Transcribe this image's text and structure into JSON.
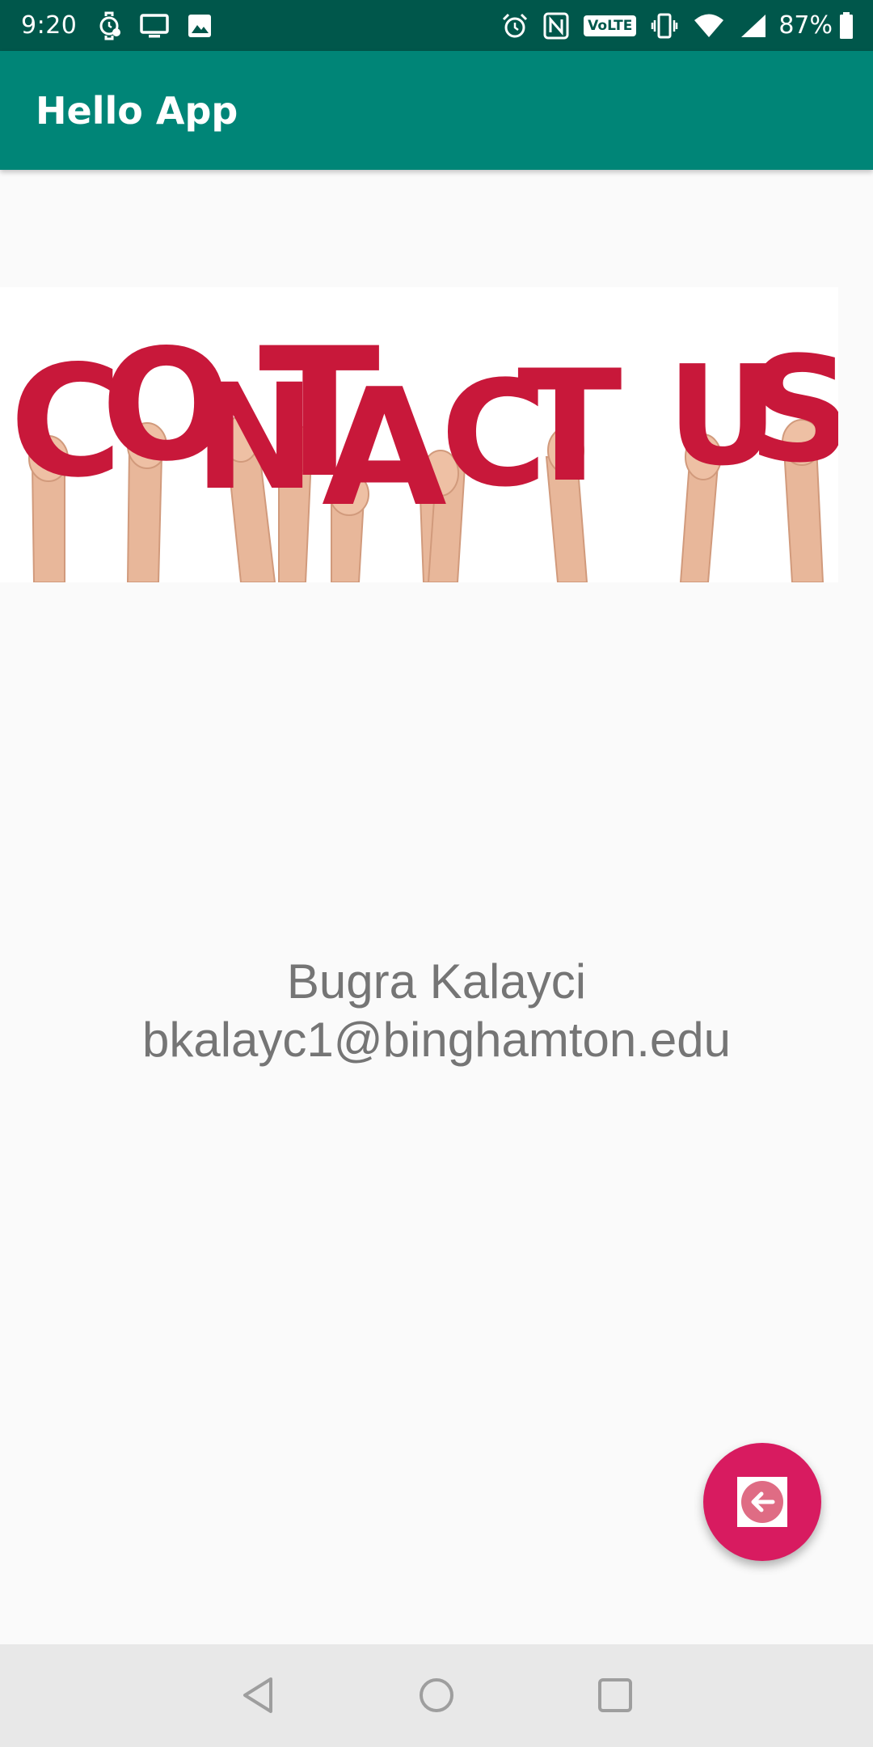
{
  "status_bar": {
    "time": "9:20",
    "volte_label": "VoLTE",
    "battery_percent": "87%",
    "left_icons": [
      "watch-icon",
      "monitor-icon",
      "image-icon"
    ],
    "right_icons": [
      "alarm-icon",
      "nfc-icon",
      "volte-icon",
      "vibrate-icon",
      "wifi-icon",
      "signal-icon",
      "battery-icon"
    ]
  },
  "app_bar": {
    "title": "Hello App"
  },
  "banner": {
    "image_text": "CONTACT US",
    "letter_color": "#c8183a"
  },
  "contact": {
    "name": "Bugra Kalayci",
    "email": "bkalayc1@binghamton.edu"
  },
  "fab": {
    "icon": "arrow-left-icon",
    "color": "#d81b60"
  },
  "nav_bar": {
    "buttons": [
      "back-icon",
      "home-icon",
      "recents-icon"
    ]
  },
  "colors": {
    "status_bar": "#00574b",
    "app_bar": "#008577",
    "background": "#fafafa",
    "text": "#757575",
    "accent": "#d81b60"
  }
}
